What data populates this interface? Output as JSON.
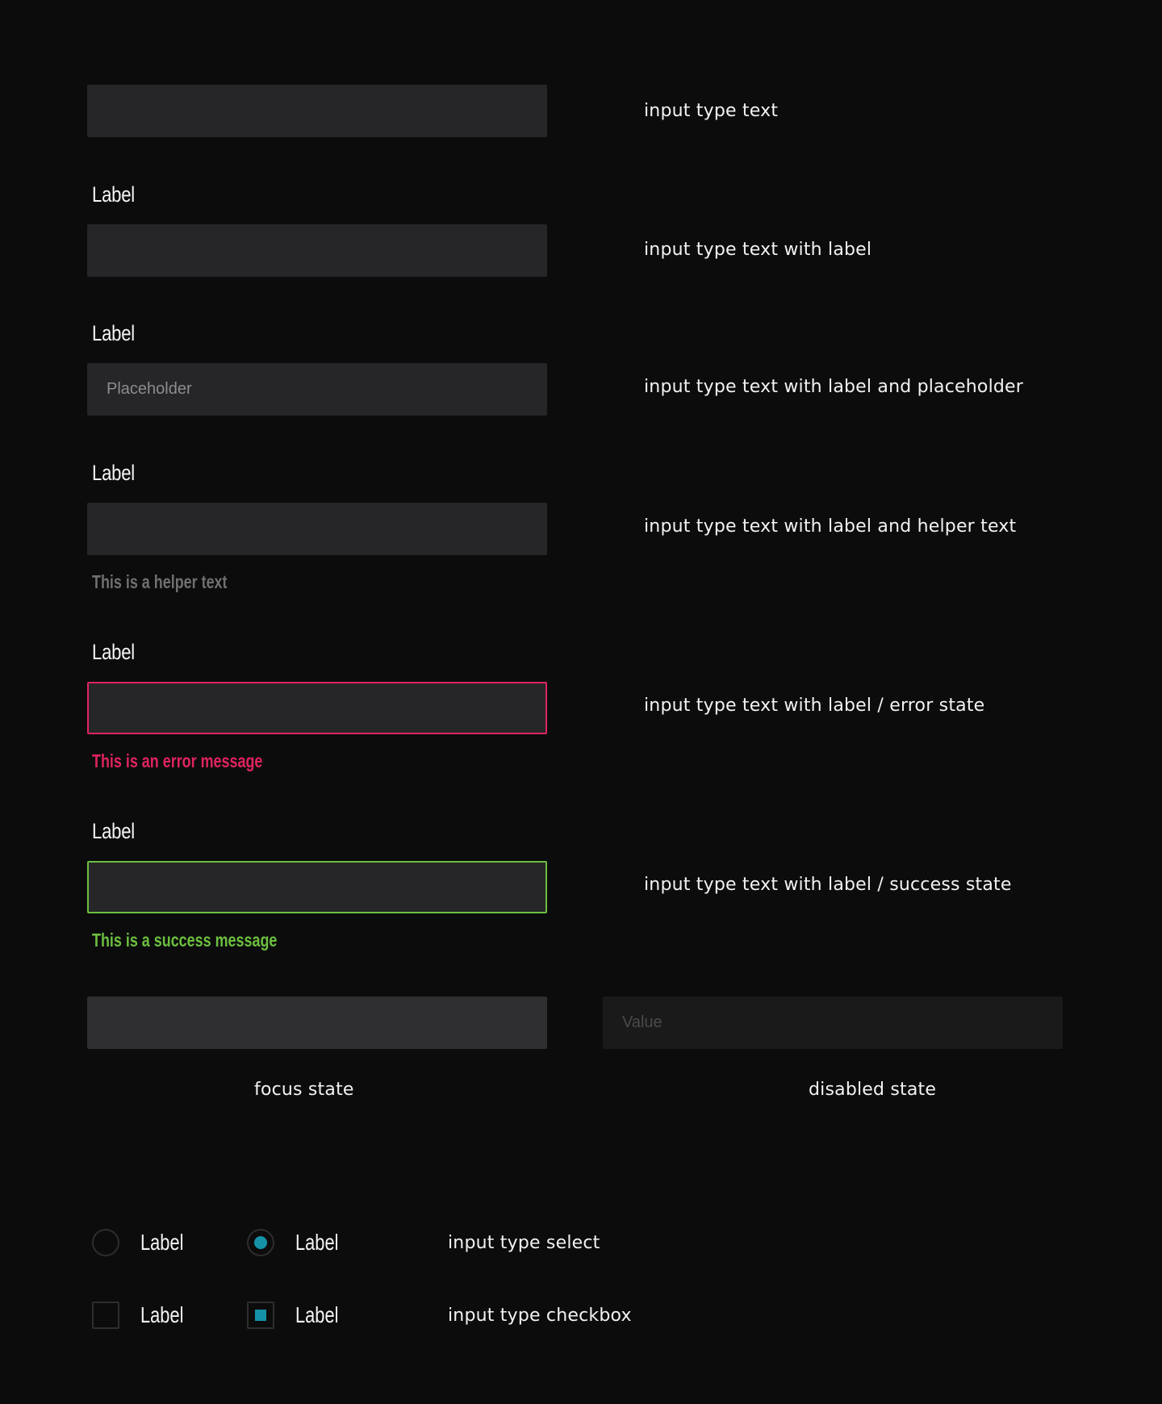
{
  "rows": {
    "text": {
      "description": "input type text"
    },
    "with_label": {
      "label": "Label",
      "description": "input type text with label"
    },
    "with_placeholder": {
      "label": "Label",
      "placeholder": "Placeholder",
      "description": "input type text with label and placeholder"
    },
    "with_helper": {
      "label": "Label",
      "helper": "This is a helper text",
      "description": "input type text with label and helper text"
    },
    "error": {
      "label": "Label",
      "message": "This is an error message",
      "description": "input type text with label / error state"
    },
    "success": {
      "label": "Label",
      "message": "This is a success message",
      "description": "input type text with label / success state"
    },
    "focus": {
      "caption": "focus state"
    },
    "disabled": {
      "value": "Value",
      "caption": "disabled state"
    }
  },
  "select": {
    "options": [
      {
        "label": "Label",
        "checked": false
      },
      {
        "label": "Label",
        "checked": true
      }
    ],
    "description": "input type select"
  },
  "checkbox": {
    "options": [
      {
        "label": "Label",
        "checked": false
      },
      {
        "label": "Label",
        "checked": true
      }
    ],
    "description": "input type checkbox"
  },
  "colors": {
    "background": "#0c0c0d",
    "field": "#262628",
    "error": "#e0245e",
    "success": "#6cbf3f",
    "accent": "#1592a8",
    "helper": "#707073"
  }
}
